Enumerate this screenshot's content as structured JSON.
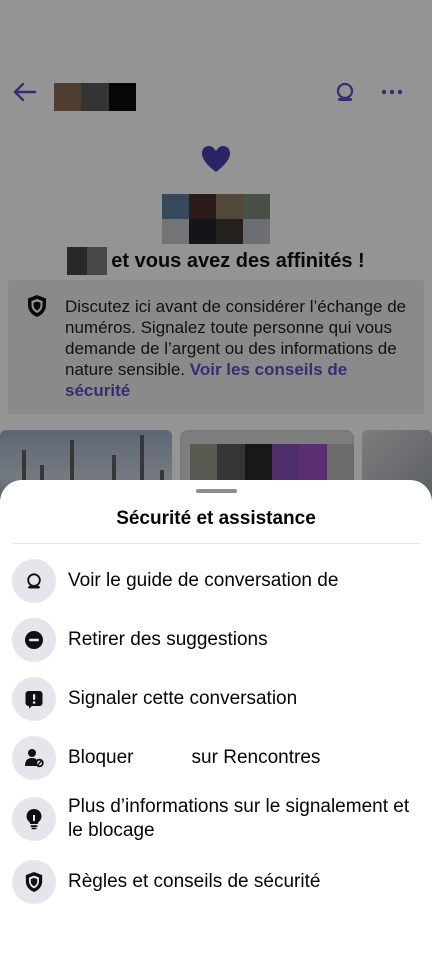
{
  "background": {
    "match_text": "et vous avez des affinités !",
    "safety_text": "Discutez ici avant de considérer l’échange de numéros. Signalez toute personne qui vous demande de l’argent ou des informations de nature sensible.",
    "safety_link": "Voir les conseils de sécurité",
    "accent_color": "#5b4fc4"
  },
  "sheet": {
    "title": "Sécurité et assistance",
    "items": [
      {
        "label": "Voir le guide de conversation de",
        "icon": "chat-guide-icon"
      },
      {
        "label": "Retirer des suggestions",
        "icon": "minus-circle-icon"
      },
      {
        "label": "Signaler cette conversation",
        "icon": "report-icon"
      },
      {
        "label": "Bloquer           sur Rencontres",
        "icon": "block-user-icon"
      },
      {
        "label": "Plus d’informations sur le signalement et le blocage",
        "icon": "lightbulb-icon"
      },
      {
        "label": "Règles et conseils de sécurité",
        "icon": "shield-icon"
      }
    ]
  }
}
